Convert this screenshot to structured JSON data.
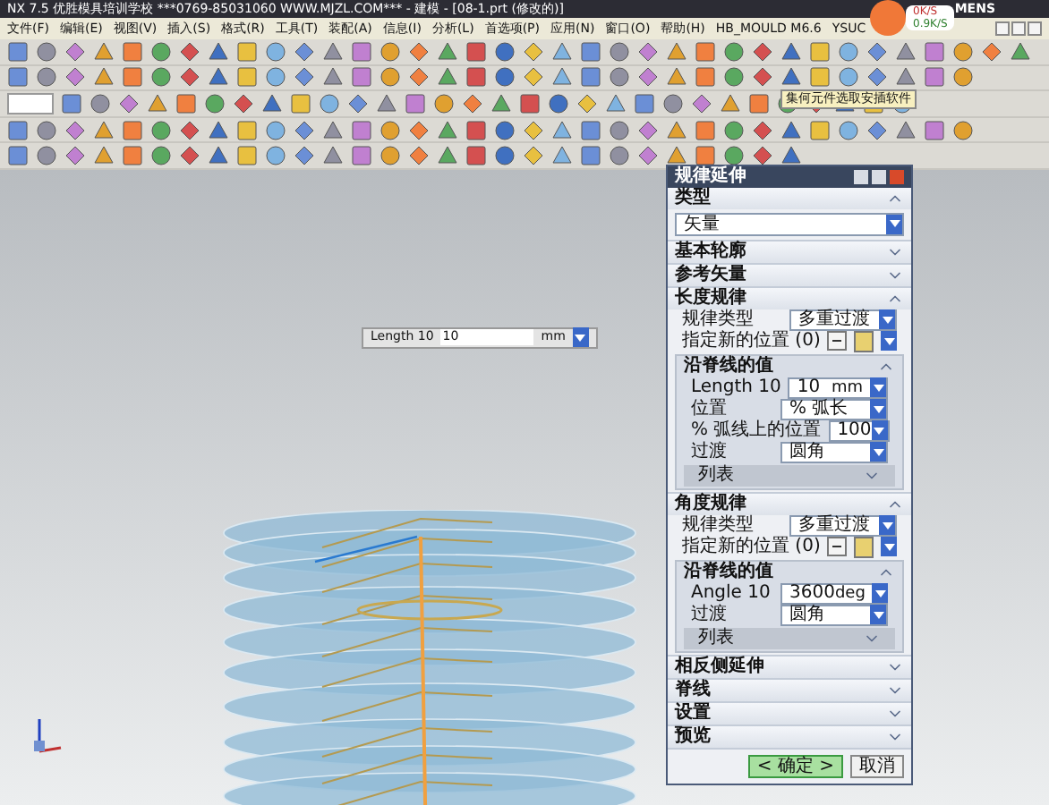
{
  "window": {
    "title": "NX 7.5 优胜模具培训学校 ***0769-85031060 WWW.MJZL.COM*** - 建模 - [08-1.prt (修改的)]",
    "brand": "MENS"
  },
  "network_badge": {
    "upload": "0K/S",
    "download": "0.9K/S"
  },
  "menu": [
    "文件(F)",
    "编辑(E)",
    "视图(V)",
    "插入(S)",
    "格式(R)",
    "工具(T)",
    "装配(A)",
    "信息(I)",
    "分析(L)",
    "首选项(P)",
    "应用(N)",
    "窗口(O)",
    "帮助(H)",
    "HB_MOULD M6.6",
    "YSUC"
  ],
  "tooltip": "集何元件选取安插软件",
  "viewport": {
    "length_field": {
      "label": "Length 10",
      "value": "10",
      "unit": "mm"
    }
  },
  "dialog": {
    "title": "规律延伸",
    "sections": [
      {
        "title": "类型",
        "expanded": true,
        "rows": [
          {
            "kind": "dropdown",
            "value": "矢量"
          }
        ]
      },
      {
        "title": "基本轮廓",
        "expanded": false
      },
      {
        "title": "参考矢量",
        "expanded": false
      },
      {
        "title": "长度规律",
        "expanded": true,
        "rows": [
          {
            "kind": "select",
            "label": "规律类型",
            "value": "多重过渡"
          },
          {
            "kind": "point",
            "label": "指定新的位置 (0)"
          },
          {
            "kind": "group",
            "title": "沿脊线的值",
            "expanded": true,
            "rows": [
              {
                "kind": "input",
                "label": "Length 10",
                "value": "10",
                "unit": "mm"
              },
              {
                "kind": "select",
                "label": "位置",
                "value": "% 弧长"
              },
              {
                "kind": "input",
                "label": "% 弧线上的位置",
                "value": "100"
              },
              {
                "kind": "select",
                "label": "过渡",
                "value": "圆角"
              },
              {
                "kind": "list",
                "title": "列表",
                "expanded": false
              }
            ]
          }
        ]
      },
      {
        "title": "角度规律",
        "expanded": true,
        "rows": [
          {
            "kind": "select",
            "label": "规律类型",
            "value": "多重过渡"
          },
          {
            "kind": "point",
            "label": "指定新的位置 (0)"
          },
          {
            "kind": "group",
            "title": "沿脊线的值",
            "expanded": true,
            "rows": [
              {
                "kind": "input",
                "label": "Angle 10",
                "value": "3600",
                "unit": "deg"
              },
              {
                "kind": "select",
                "label": "过渡",
                "value": "圆角"
              },
              {
                "kind": "list",
                "title": "列表",
                "expanded": false
              }
            ]
          }
        ]
      },
      {
        "title": "相反侧延伸",
        "expanded": false
      },
      {
        "title": "脊线",
        "expanded": false
      },
      {
        "title": "设置",
        "expanded": false
      },
      {
        "title": "预览",
        "expanded": false
      }
    ],
    "buttons": [
      {
        "label": "< 确定 >",
        "kind": "primary"
      },
      {
        "label": "取消",
        "kind": "normal"
      }
    ]
  }
}
